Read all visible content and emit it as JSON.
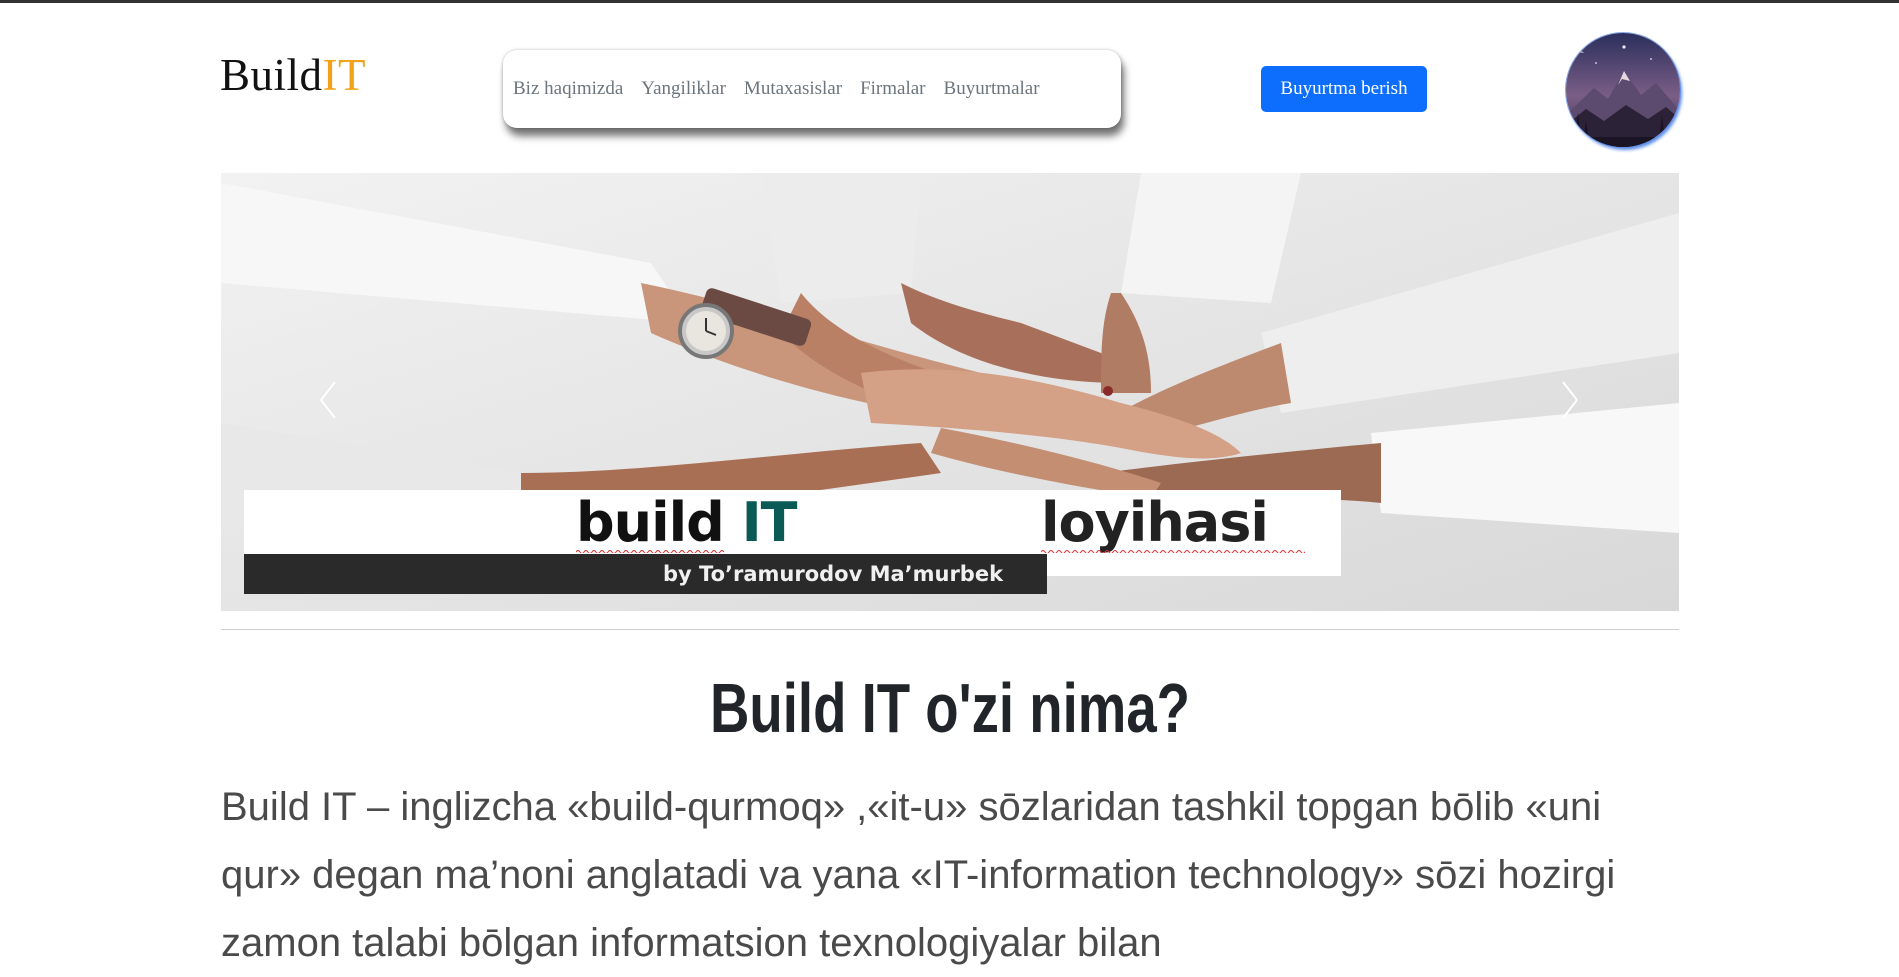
{
  "brand": {
    "part1": "Build",
    "part2": "IT",
    "accent_color": "#f0a21a"
  },
  "nav": {
    "items": [
      {
        "label": "Biz haqimizda"
      },
      {
        "label": "Yangiliklar"
      },
      {
        "label": "Mutaxasislar"
      },
      {
        "label": "Firmalar"
      },
      {
        "label": "Buyurtmalar"
      }
    ]
  },
  "header": {
    "order_button": "Buyurtma berish",
    "button_color": "#0d6efd",
    "avatar_icon": "mountain-landscape-avatar"
  },
  "carousel": {
    "banner_word1": "build",
    "banner_word1_accent": "IT",
    "banner_word2": "loyihasi",
    "byline": "by To’ramurodov Ma’murbek",
    "prev_icon": "chevron-left-icon",
    "next_icon": "chevron-right-icon"
  },
  "main": {
    "heading": "Build IT o'zi nima?",
    "paragraph": "Build IT – inglizcha «build-qurmoq» ,«it-u» sōzlaridan tashkil topgan bōlib «uni qur» degan ma’noni anglatadi va yana «IT-information technology» sōzi hozirgi zamon talabi bōlgan informatsion texnologiyalar bilan"
  }
}
